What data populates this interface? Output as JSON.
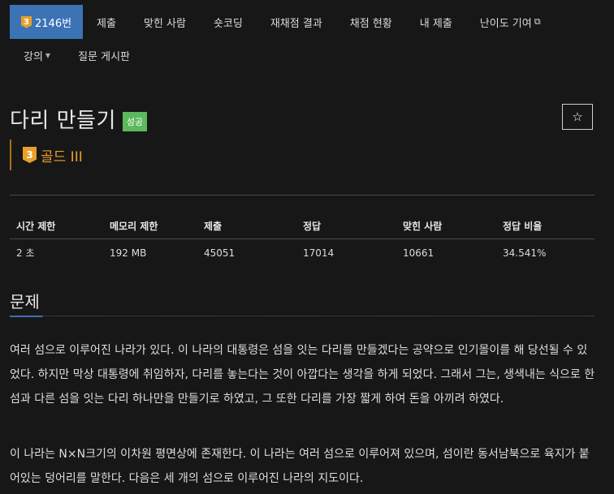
{
  "nav": {
    "primary": [
      {
        "label": "2146번",
        "active": true,
        "tier_digit": "3"
      },
      {
        "label": "제출"
      },
      {
        "label": "맞힌 사람"
      },
      {
        "label": "숏코딩"
      },
      {
        "label": "재채점 결과"
      },
      {
        "label": "채점 현황"
      },
      {
        "label": "내 제출"
      },
      {
        "label": "난이도 기여"
      }
    ],
    "secondary": [
      {
        "label": "강의"
      },
      {
        "label": "질문 게시판"
      }
    ]
  },
  "problem": {
    "title": "다리 만들기",
    "result_label": "성공",
    "tier_digit": "3",
    "tier_label": "골드 III"
  },
  "stats": {
    "headers": [
      "시간 제한",
      "메모리 제한",
      "제출",
      "정답",
      "맞힌 사람",
      "정답 비율"
    ],
    "row": [
      "2 초",
      "192 MB",
      "45051",
      "17014",
      "10661",
      "34.541%"
    ]
  },
  "section": {
    "title": "문제",
    "paragraphs": [
      "여러 섬으로 이루어진 나라가 있다. 이 나라의 대통령은 섬을 잇는 다리를 만들겠다는 공약으로 인기몰이를 해 당선될 수 있었다. 하지만 막상 대통령에 취임하자, 다리를 놓는다는 것이 아깝다는 생각을 하게 되었다. 그래서 그는, 생색내는 식으로 한 섬과 다른 섬을 잇는 다리 하나만을 만들기로 하였고, 그 또한 다리를 가장 짧게 하여 돈을 아끼려 하였다.",
      "이 나라는 N×N크기의 이차원 평면상에 존재한다. 이 나라는 여러 섬으로 이루어져 있으며, 섬이란 동서남북으로 육지가 붙어있는 덩어리를 말한다. 다음은 세 개의 섬으로 이루어진 나라의 지도이다."
    ]
  },
  "colors": {
    "accent": "#3b73b5",
    "gold": "#e8a028",
    "success": "#5cb85c",
    "background": "#171717"
  }
}
